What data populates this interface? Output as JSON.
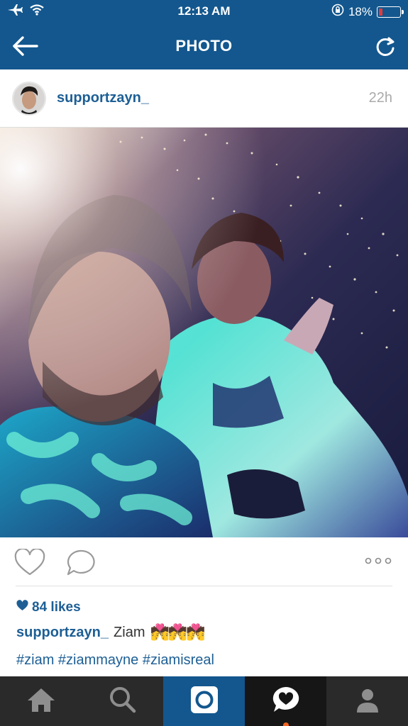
{
  "status_bar": {
    "time": "12:13 AM",
    "battery_percent": "18%",
    "battery_level": 0.18,
    "icons": [
      "airplane-icon",
      "wifi-icon",
      "orientation-lock-icon",
      "battery-icon"
    ]
  },
  "header": {
    "title": "PHOTO",
    "back_icon": "back-arrow-icon",
    "refresh_icon": "refresh-icon"
  },
  "post": {
    "username": "supportzayn_",
    "time_ago": "22h",
    "likes": "84 likes",
    "caption_user": "supportzayn_",
    "caption_text": "Ziam",
    "caption_emojis": "💏💏💏",
    "hashtags": "#ziam #ziammayne #ziamisreal"
  },
  "tabs": [
    {
      "name": "home-icon"
    },
    {
      "name": "search-icon"
    },
    {
      "name": "camera-icon"
    },
    {
      "name": "activity-icon"
    },
    {
      "name": "profile-icon"
    }
  ],
  "colors": {
    "brand_blue": "#13578e",
    "link_blue": "#1d5f95",
    "tabbar_bg": "#2a2a2a",
    "notification_orange": "#f26522",
    "battery_low": "#e23b3b"
  }
}
